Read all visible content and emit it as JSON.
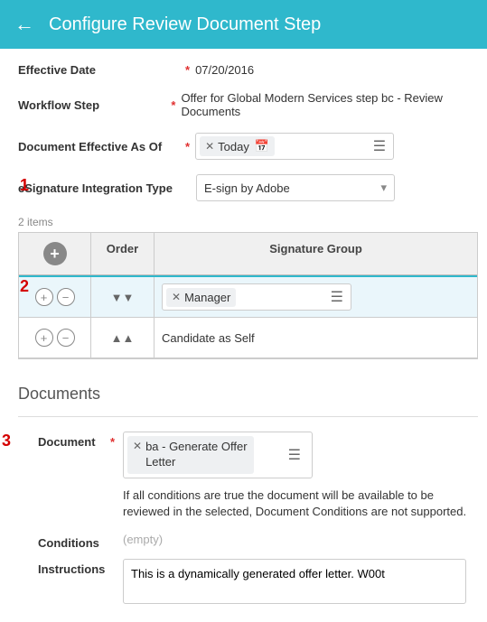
{
  "header": {
    "title": "Configure Review Document Step"
  },
  "form": {
    "effective_date": {
      "label": "Effective Date",
      "value": "07/20/2016"
    },
    "workflow_step": {
      "label": "Workflow Step",
      "value": "Offer for Global Modern Services step bc - Review Documents"
    },
    "doc_eff_as_of": {
      "label": "Document Effective As Of",
      "pill": "Today"
    },
    "esig_type": {
      "label": "eSignature Integration Type",
      "value": "E-sign by Adobe"
    }
  },
  "annotations": {
    "one": "1",
    "two": "2",
    "three": "3"
  },
  "grid": {
    "count_label": "2 items",
    "headers": {
      "order": "Order",
      "sig_group": "Signature Group"
    },
    "rows": [
      {
        "sig": "Manager",
        "active": true
      },
      {
        "sig": "Candidate as Self",
        "active": false
      }
    ]
  },
  "documents": {
    "title": "Documents",
    "doc_label": "Document",
    "doc_pill": "ba - Generate Offer Letter",
    "help_text": "If all conditions are true the document will be available to be reviewed in the selected, Document Conditions are not supported.",
    "conditions_label": "Conditions",
    "conditions_value": "(empty)",
    "instructions_label": "Instructions",
    "instructions_value": "This is a dynamically generated offer letter. W00t"
  }
}
